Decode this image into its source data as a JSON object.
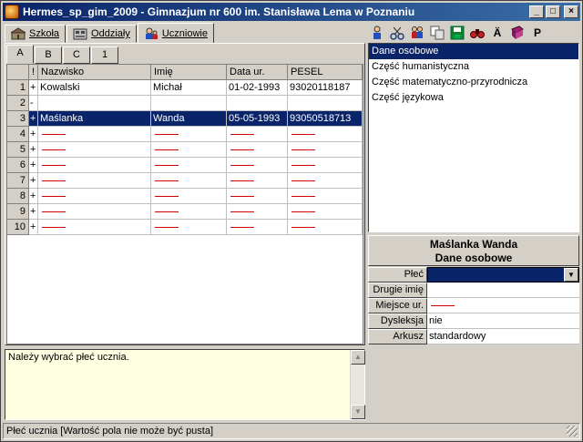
{
  "window": {
    "title": "Hermes_sp_gim_2009 - Gimnazjum nr 600 im. Stanisława Lema w Poznaniu",
    "buttons": {
      "minimize": "_",
      "maximize": "□",
      "close": "×"
    }
  },
  "tabs": [
    {
      "label": "Szkoła",
      "icon": "school-icon"
    },
    {
      "label": "Oddziały",
      "icon": "classes-icon"
    },
    {
      "label": "Uczniowie",
      "icon": "students-icon",
      "active": true
    }
  ],
  "toolbar": {
    "icons": [
      "add-student-icon",
      "cut-icon",
      "move-students-icon",
      "copy-icon",
      "save-icon",
      "search-icon",
      "umlaut-a-icon",
      "book-icon",
      "p-icon"
    ],
    "umlaut_label": "Ä",
    "p_label": "P"
  },
  "subtabs": [
    "A",
    "B",
    "C",
    "1"
  ],
  "grid": {
    "headers": {
      "excl": "!",
      "surname": "Nazwisko",
      "name": "Imię",
      "dob": "Data ur.",
      "pesel": "PESEL"
    },
    "rows": [
      {
        "n": "1",
        "flag": "+",
        "surname": "Kowalski",
        "name": "Michał",
        "dob": "01-02-1993",
        "pesel": "93020118187"
      },
      {
        "n": "2",
        "flag": "-",
        "surname": "",
        "name": "",
        "dob": "",
        "pesel": ""
      },
      {
        "n": "3",
        "flag": "+",
        "surname": "Maślanka",
        "name": "Wanda",
        "dob": "05-05-1993",
        "pesel": "93050518713"
      },
      {
        "n": "4",
        "flag": "+"
      },
      {
        "n": "5",
        "flag": "+"
      },
      {
        "n": "6",
        "flag": "+"
      },
      {
        "n": "7",
        "flag": "+"
      },
      {
        "n": "8",
        "flag": "+"
      },
      {
        "n": "9",
        "flag": "+"
      },
      {
        "n": "10",
        "flag": "+"
      }
    ]
  },
  "message": "Należy wybrać płeć ucznia.",
  "status": "Płeć ucznia [Wartość pola nie może być pusta]",
  "sections": [
    "Dane osobowe",
    "Część humanistyczna",
    "Część matematyczno-przyrodnicza",
    "Część językowa"
  ],
  "details": {
    "name": "Maślanka Wanda",
    "section": "Dane osobowe",
    "fields": [
      {
        "label": "Płeć",
        "value": ""
      },
      {
        "label": "Drugie imię",
        "value": ""
      },
      {
        "label": "Miejsce ur.",
        "value": ""
      },
      {
        "label": "Dysleksja",
        "value": "nie"
      },
      {
        "label": "Arkusz",
        "value": "standardowy"
      }
    ]
  }
}
